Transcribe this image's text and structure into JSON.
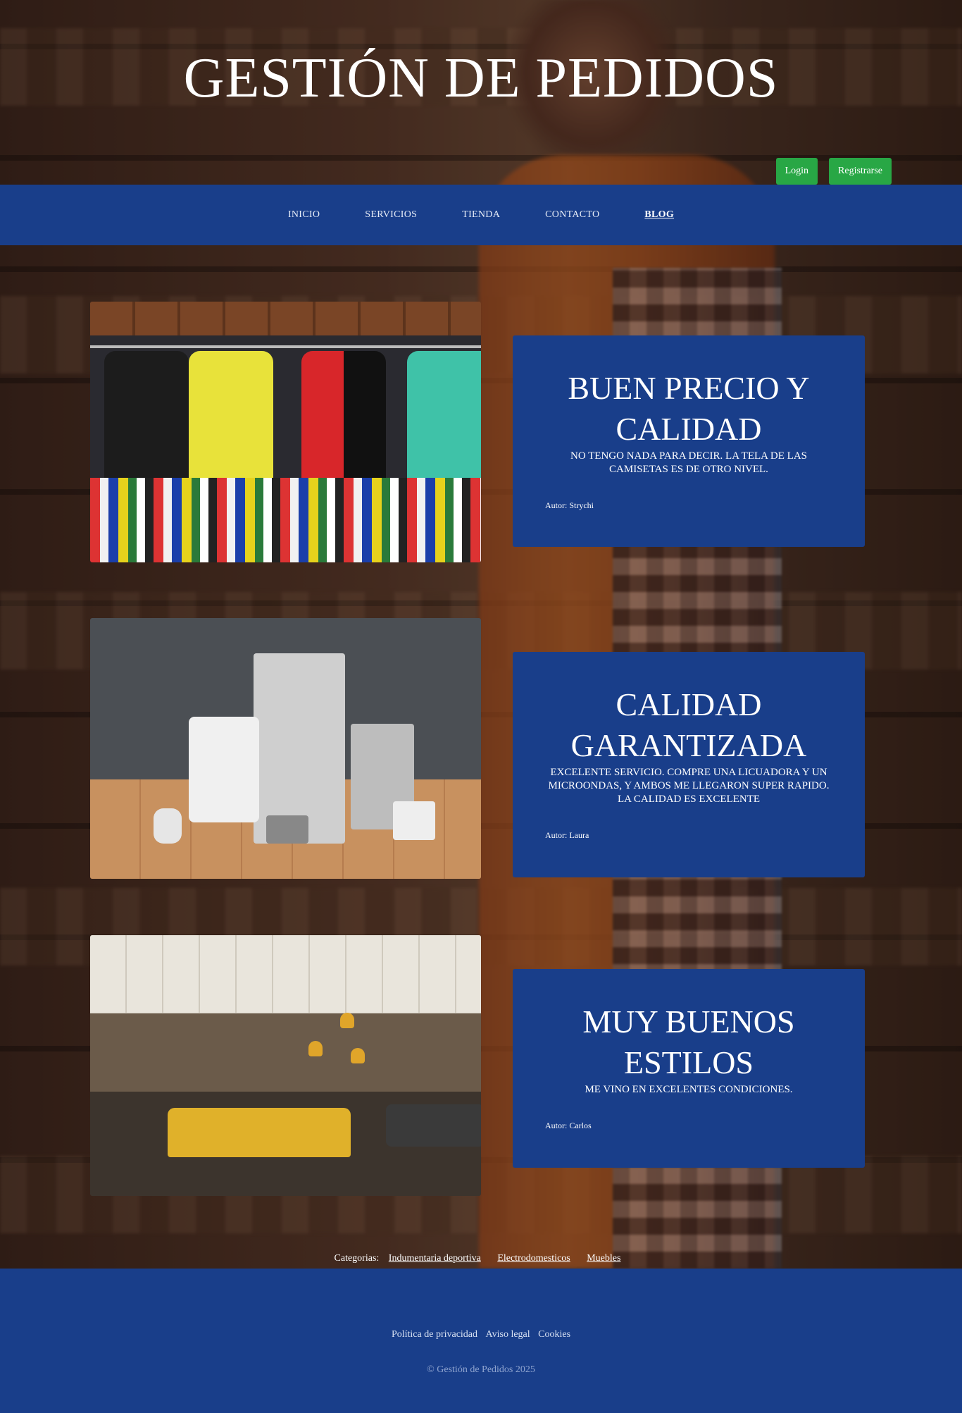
{
  "header": {
    "title": "GESTIÓN DE PEDIDOS",
    "login_label": "Login",
    "register_label": "Registrarse"
  },
  "nav": {
    "items": [
      {
        "label": "INICIO"
      },
      {
        "label": "SERVICIOS"
      },
      {
        "label": "TIENDA"
      },
      {
        "label": "CONTACTO"
      },
      {
        "label": "BLOG",
        "active": true
      }
    ]
  },
  "reviews": [
    {
      "title": "BUEN PRECIO Y CALIDAD",
      "body": "NO TENGO NADA PARA DECIR. LA TELA DE LAS CAMISETAS ES DE OTRO NIVEL.",
      "author": "Autor: Strychi"
    },
    {
      "title": "CALIDAD GARANTIZADA",
      "body": "EXCELENTE SERVICIO. COMPRE UNA LICUADORA Y UN MICROONDAS, Y AMBOS ME LLEGARON SUPER RAPIDO. LA CALIDAD ES EXCELENTE",
      "author": "Autor: Laura"
    },
    {
      "title": "MUY BUENOS ESTILOS",
      "body": "ME VINO EN EXCELENTES CONDICIONES.",
      "author": "Autor: Carlos"
    }
  ],
  "categories": {
    "label": "Categorias:",
    "items": [
      "Indumentaria deportiva",
      "Electrodomesticos",
      "Muebles"
    ]
  },
  "footer": {
    "links": [
      "Política de privacidad",
      "Aviso legal",
      "Cookies"
    ],
    "copyright": "© Gestión de Pedidos 2025"
  },
  "colors": {
    "primary_blue": "#193e8a",
    "button_green": "#28a745"
  }
}
